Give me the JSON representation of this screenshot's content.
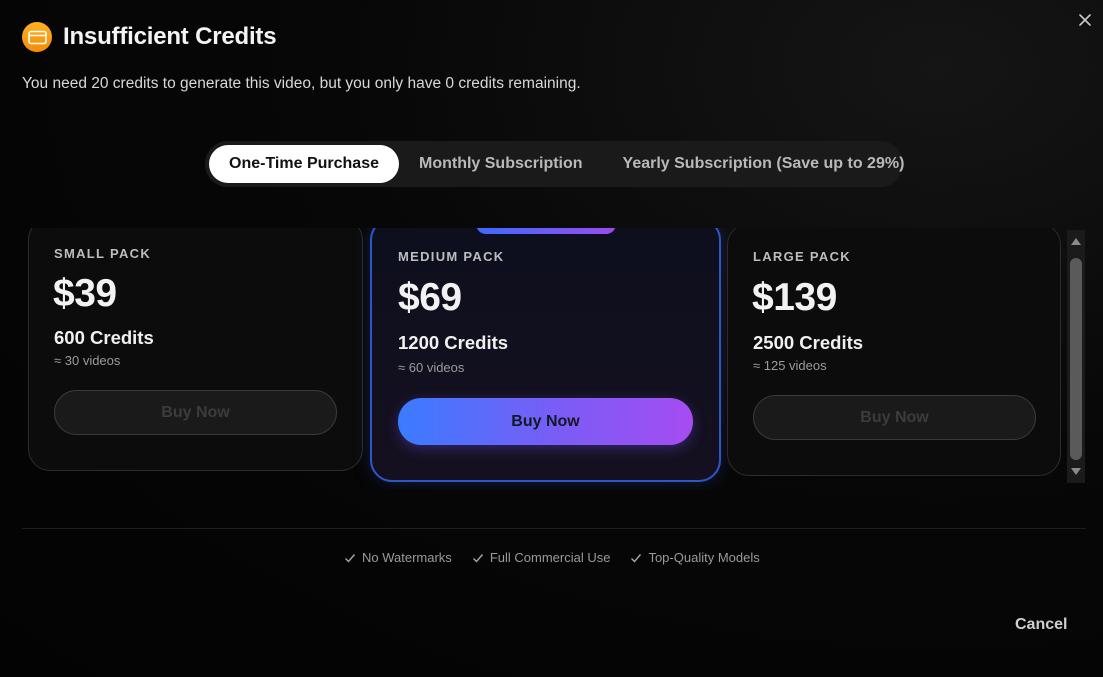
{
  "dialog": {
    "title": "Insufficient Credits",
    "subtitle": "You need 20 credits to generate this video, but you only have 0 credits remaining.",
    "accent_color": "#f5a00f"
  },
  "tabs": [
    {
      "label": "One-Time Purchase",
      "active": true
    },
    {
      "label": "Monthly Subscription",
      "active": false
    },
    {
      "label": "Yearly Subscription (Save up to 29%)",
      "active": false
    }
  ],
  "packs": {
    "small": {
      "name": "SMALL PACK",
      "price": "$39",
      "credits": "600 Credits",
      "videos": "≈ 30 videos",
      "button": "Buy Now"
    },
    "medium": {
      "name": "MEDIUM PACK",
      "price": "$69",
      "credits": "1200 Credits",
      "videos": "≈ 60 videos",
      "button": "Buy Now"
    },
    "large": {
      "name": "LARGE PACK",
      "price": "$139",
      "credits": "2500 Credits",
      "videos": "≈ 125 videos",
      "button": "Buy Now"
    }
  },
  "features": [
    {
      "label": "No Watermarks",
      "icon": "check-icon"
    },
    {
      "label": "Full Commercial Use",
      "icon": "check-icon"
    },
    {
      "label": "Top-Quality Models",
      "icon": "check-icon"
    }
  ],
  "footer": {
    "cancel_label": "Cancel"
  }
}
